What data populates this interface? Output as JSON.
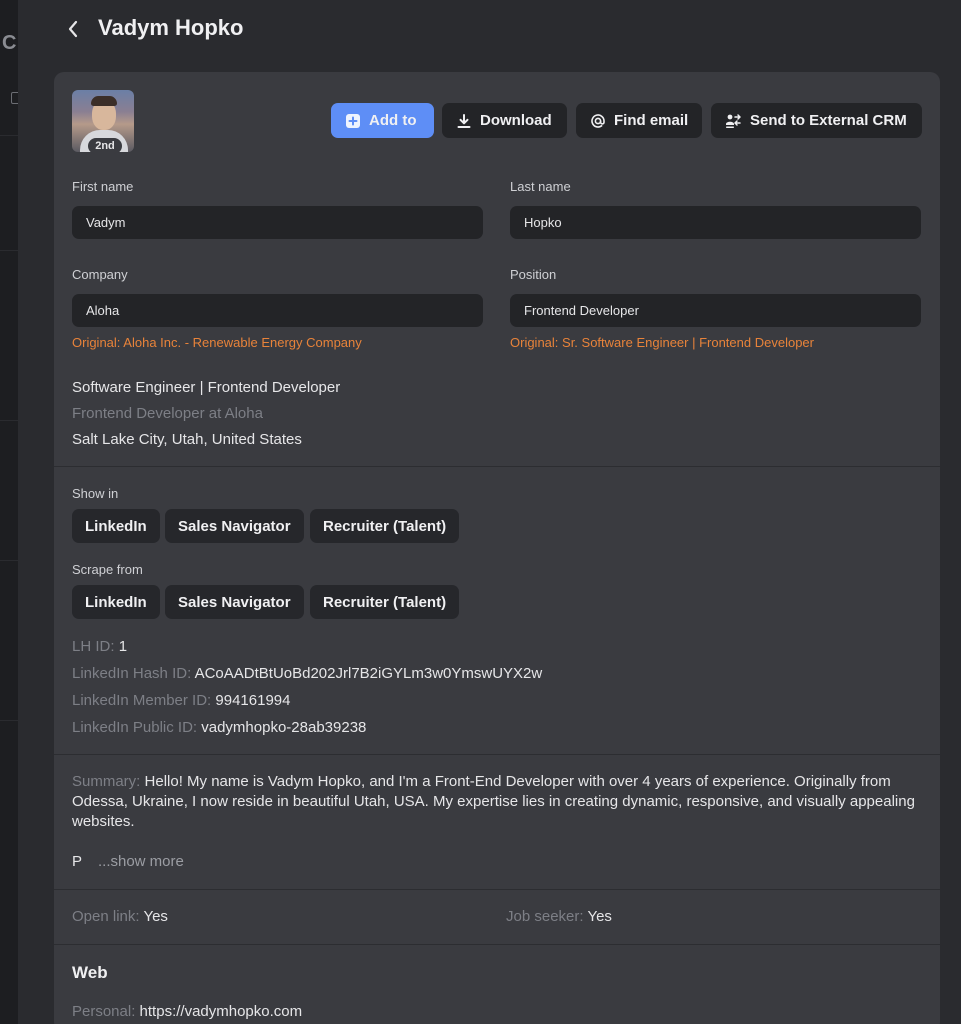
{
  "header": {
    "title": "Vadym Hopko"
  },
  "profile": {
    "degree_badge": "2nd"
  },
  "actions": {
    "add_to": "Add to",
    "download": "Download",
    "find_email": "Find email",
    "send_crm": "Send to External CRM"
  },
  "fields": {
    "first_name_label": "First name",
    "first_name_value": "Vadym",
    "last_name_label": "Last name",
    "last_name_value": "Hopko",
    "company_label": "Company",
    "company_value": "Aloha",
    "company_original": "Original: Aloha Inc. - Renewable Energy Company",
    "position_label": "Position",
    "position_value": "Frontend Developer",
    "position_original": "Original: Sr. Software Engineer | Frontend Developer"
  },
  "headline": {
    "title": "Software Engineer | Frontend Developer",
    "subtitle": "Frontend Developer at Aloha",
    "location": "Salt Lake City, Utah, United States"
  },
  "show_in": {
    "label": "Show in",
    "items": [
      "LinkedIn",
      "Sales Navigator",
      "Recruiter (Talent)"
    ]
  },
  "scrape_from": {
    "label": "Scrape from",
    "items": [
      "LinkedIn",
      "Sales Navigator",
      "Recruiter (Talent)"
    ]
  },
  "ids": {
    "lh_label": "LH ID:",
    "lh_value": "1",
    "hash_label": "LinkedIn Hash ID:",
    "hash_value": "ACoAADtBtUoBd202Jrl7B2iGYLm3w0YmswUYX2w",
    "member_label": "LinkedIn Member ID:",
    "member_value": "994161994",
    "public_label": "LinkedIn Public ID:",
    "public_value": "vadymhopko-28ab39238"
  },
  "summary": {
    "label": "Summary:",
    "text": "Hello! My name is Vadym Hopko, and I'm a Front-End Developer with over 4 years of experience. Originally from Odessa, Ukraine, I now reside in beautiful Utah, USA. My expertise lies in creating dynamic, responsive, and visually appealing websites.",
    "truncated_start": "P",
    "show_more": "...show more"
  },
  "flags": {
    "open_link_label": "Open link:",
    "open_link_value": "Yes",
    "job_seeker_label": "Job seeker:",
    "job_seeker_value": "Yes"
  },
  "web": {
    "title": "Web",
    "personal_label": "Personal:",
    "personal_value": "https://vadymhopko.com"
  },
  "colors": {
    "accent": "#5e8ef6",
    "original_text": "#e8833a",
    "card_bg": "#3a3b40",
    "input_bg": "#232427"
  },
  "icons": {
    "back": "chevron-left-icon",
    "add": "plus-square-icon",
    "download": "download-icon",
    "email": "at-sign-icon",
    "crm": "users-transfer-icon"
  }
}
